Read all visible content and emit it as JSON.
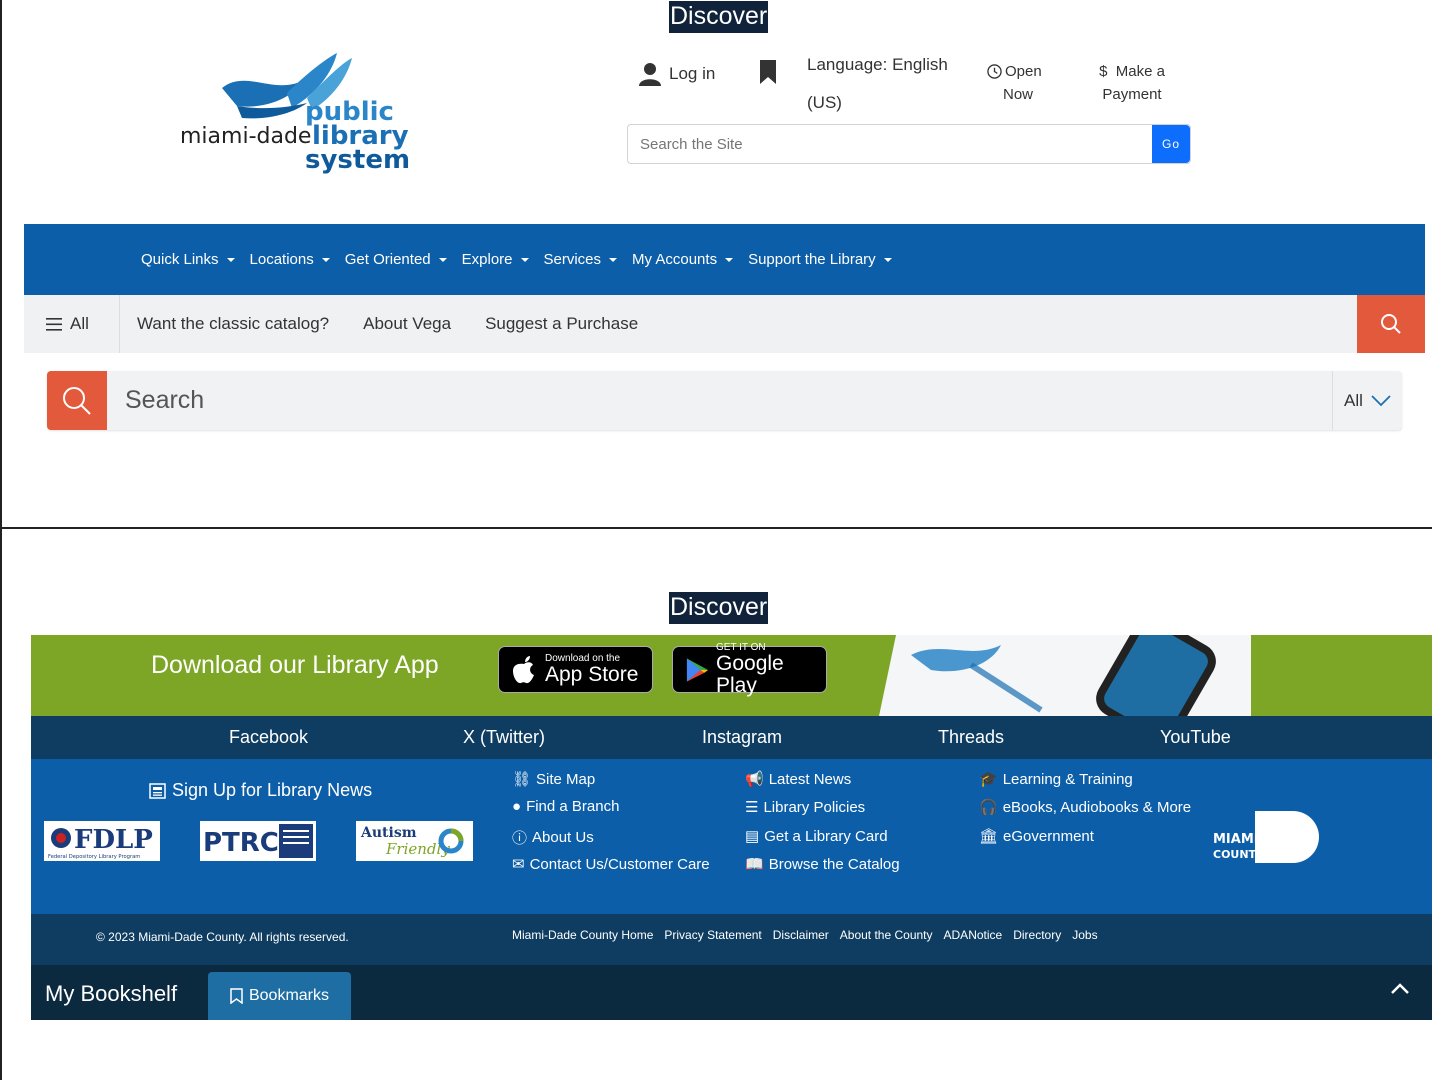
{
  "header": {
    "discover_label": "Discover",
    "logo": {
      "line1": "public",
      "line2a": "miami-dade",
      "line2b": "library",
      "line3": "system"
    },
    "login": "Log in",
    "language_line1": "Language: English",
    "language_line2": "(US)",
    "open_line1": "Open",
    "open_line2": "Now",
    "payment_line1": "$  Make a",
    "payment_line2": "Payment",
    "search_placeholder": "Search the Site",
    "go_label": "Go"
  },
  "mainnav": {
    "items": [
      "Quick Links",
      "Locations",
      "Get Oriented",
      "Explore",
      "Services",
      "My Accounts",
      "Support the Library"
    ]
  },
  "vega": {
    "all_label": "All",
    "links": [
      "Want the classic catalog?",
      "About Vega",
      "Suggest a Purchase"
    ],
    "search_placeholder": "Search",
    "scope": "All"
  },
  "footer": {
    "discover_label": "Discover",
    "app_banner_title": "Download our Library App",
    "appstore_small": "Download on the",
    "appstore_big": "App Store",
    "googleplay_small": "GET IT ON",
    "googleplay_big": "Google Play",
    "social": [
      "Facebook",
      "X (Twitter)",
      "Instagram",
      "Threads",
      "YouTube"
    ],
    "signup": "Sign Up for Library News",
    "badges": {
      "fdlp": "FDLP",
      "fdlp_sub": "Federal Depository Library Program",
      "ptrc": "PTRC",
      "autism1": "Autism",
      "autism2": "Friendly"
    },
    "col1": [
      "Site Map",
      "Find a Branch",
      "About Us",
      "Contact Us/Customer Care"
    ],
    "col2": [
      "Latest News",
      "Library Policies",
      "Get a Library Card",
      "Browse the Catalog"
    ],
    "col3": [
      "Learning & Training",
      "eBooks, Audiobooks & More",
      "eGovernment"
    ],
    "county_logo1": "MIAMI-DADE",
    "county_logo2": "COUNTY",
    "copyright": "© 2023 Miami-Dade County. All rights reserved.",
    "legal_links": [
      "Miami-Dade County Home",
      "Privacy Statement",
      "Disclaimer",
      "About the County",
      "ADANotice",
      "Directory",
      "Jobs"
    ],
    "bookshelf_title": "My Bookshelf",
    "bookmarks_tab": "Bookmarks"
  },
  "colors": {
    "brand_blue": "#0c5ea8",
    "dark_navy": "#0f3d62",
    "vega_orange": "#e3593c",
    "app_green": "#7da627",
    "go_blue": "#0d6efd"
  }
}
